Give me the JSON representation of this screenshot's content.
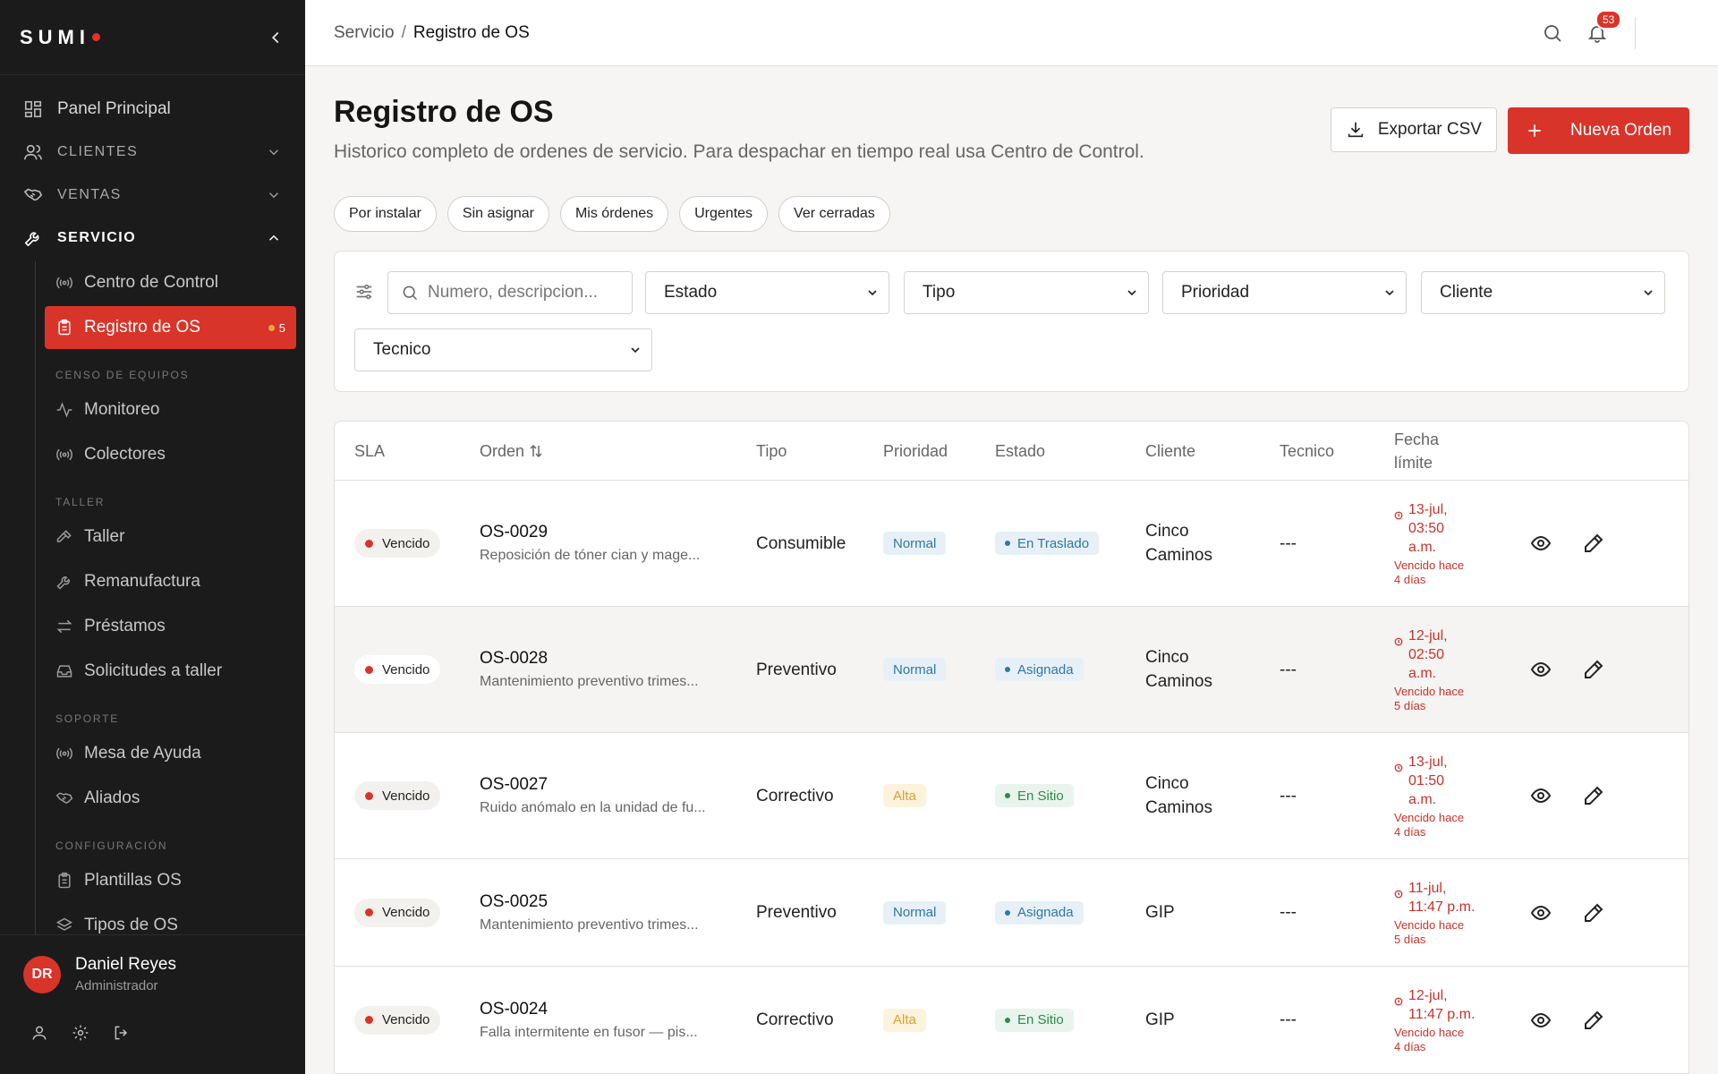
{
  "sidebar": {
    "brand": "SUMI",
    "panel": "Panel Principal",
    "clientes": "CLIENTES",
    "ventas": "VENTAS",
    "servicio": "SERVICIO",
    "centro": "Centro de Control",
    "registro": "Registro de OS",
    "registro_badge": "5",
    "censo_title": "CENSO DE EQUIPOS",
    "monitoreo": "Monitoreo",
    "colectores": "Colectores",
    "taller_title": "TALLER",
    "taller": "Taller",
    "remanufactura": "Remanufactura",
    "prestamos": "Préstamos",
    "solicitudes": "Solicitudes a taller",
    "soporte_title": "SOPORTE",
    "mesa": "Mesa de Ayuda",
    "aliados": "Aliados",
    "config_title": "CONFIGURACIÓN",
    "plantillas": "Plantillas OS",
    "tipos": "Tipos de OS"
  },
  "user": {
    "initials": "DR",
    "name": "Daniel Reyes",
    "role": "Administrador"
  },
  "topbar": {
    "crumb_parent": "Servicio",
    "crumb_sep": "/",
    "crumb_current": "Registro de OS",
    "notifications": "53"
  },
  "page": {
    "title": "Registro de OS",
    "description": "Historico completo de ordenes de servicio. Para despachar en tiempo real usa Centro de Control.",
    "export_label": "Exportar CSV",
    "new_label": "Nueva Orden"
  },
  "chips": [
    "Por instalar",
    "Sin asignar",
    "Mis órdenes",
    "Urgentes",
    "Ver cerradas"
  ],
  "filters": {
    "search_placeholder": "Numero, descripcion...",
    "estado": "Estado",
    "tipo": "Tipo",
    "prioridad": "Prioridad",
    "cliente": "Cliente",
    "tecnico": "Tecnico"
  },
  "table": {
    "headers": {
      "sla": "SLA",
      "orden": "Orden",
      "tipo": "Tipo",
      "prioridad": "Prioridad",
      "estado": "Estado",
      "cliente": "Cliente",
      "tecnico": "Tecnico",
      "fecha1": "Fecha",
      "fecha2": "límite"
    },
    "rows": [
      {
        "sla": "Vencido",
        "num": "OS-0029",
        "desc": "Reposición de tóner cian y mage...",
        "tipo": "Consumible",
        "prioridad": "Normal",
        "estado": "En Traslado",
        "cliente1": "Cinco",
        "cliente2": "Caminos",
        "tecnico": "---",
        "d1": "13-jul,",
        "d2": "03:50",
        "d3": "a.m.",
        "s1": "Vencido hace",
        "s2": "4 días"
      },
      {
        "sla": "Vencido",
        "num": "OS-0028",
        "desc": "Mantenimiento preventivo trimes...",
        "tipo": "Preventivo",
        "prioridad": "Normal",
        "estado": "Asignada",
        "cliente1": "Cinco",
        "cliente2": "Caminos",
        "tecnico": "---",
        "d1": "12-jul,",
        "d2": "02:50",
        "d3": "a.m.",
        "s1": "Vencido hace",
        "s2": "5 días"
      },
      {
        "sla": "Vencido",
        "num": "OS-0027",
        "desc": "Ruido anómalo en la unidad de fu...",
        "tipo": "Correctivo",
        "prioridad": "Alta",
        "estado": "En Sitio",
        "cliente1": "Cinco",
        "cliente2": "Caminos",
        "tecnico": "---",
        "d1": "13-jul,",
        "d2": "01:50",
        "d3": "a.m.",
        "s1": "Vencido hace",
        "s2": "4 días"
      },
      {
        "sla": "Vencido",
        "num": "OS-0025",
        "desc": "Mantenimiento preventivo trimes...",
        "tipo": "Preventivo",
        "prioridad": "Normal",
        "estado": "Asignada",
        "cliente1": "GIP",
        "cliente2": "",
        "tecnico": "---",
        "d1": "11-jul,",
        "d2": "11:47 p.m.",
        "d3": "",
        "s1": "Vencido hace",
        "s2": "5 días"
      },
      {
        "sla": "Vencido",
        "num": "OS-0024",
        "desc": "Falla intermitente en fusor — pis...",
        "tipo": "Correctivo",
        "prioridad": "Alta",
        "estado": "En Sitio",
        "cliente1": "GIP",
        "cliente2": "",
        "tecnico": "---",
        "d1": "12-jul,",
        "d2": "11:47 p.m.",
        "d3": "",
        "s1": "Vencido hace",
        "s2": "4 días"
      }
    ]
  }
}
